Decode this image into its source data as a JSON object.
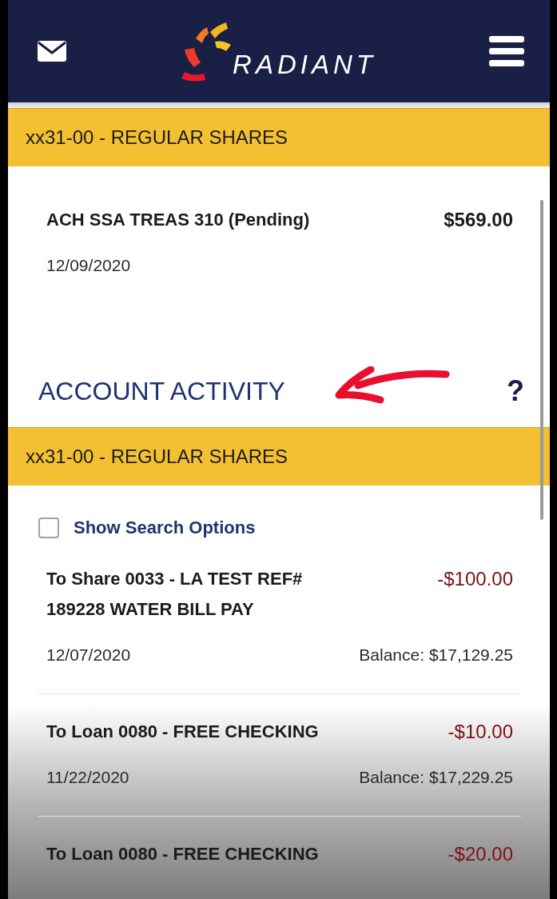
{
  "header": {
    "logo_text": "RADIANT"
  },
  "pending": {
    "account": "xx31-00 - REGULAR SHARES",
    "transactions": [
      {
        "description": "ACH SSA TREAS 310 (Pending)",
        "amount": "$569.00",
        "kind": "credit",
        "date": "12/09/2020"
      }
    ]
  },
  "activity": {
    "title": "ACCOUNT ACTIVITY",
    "help": "?",
    "account": "xx31-00 - REGULAR SHARES",
    "search_toggle": {
      "label": "Show Search Options",
      "checked": false
    },
    "transactions": [
      {
        "description": "To Share 0033 - LA TEST REF# 189228 WATER BILL PAY",
        "amount": "-$100.00",
        "kind": "debit",
        "date": "12/07/2020",
        "balance": "Balance: $17,129.25"
      },
      {
        "description": "To Loan 0080 - FREE CHECKING",
        "amount": "-$10.00",
        "kind": "debit",
        "date": "11/22/2020",
        "balance": "Balance: $17,229.25"
      },
      {
        "description": "To Loan 0080 - FREE CHECKING",
        "amount": "-$20.00",
        "kind": "debit"
      }
    ]
  }
}
